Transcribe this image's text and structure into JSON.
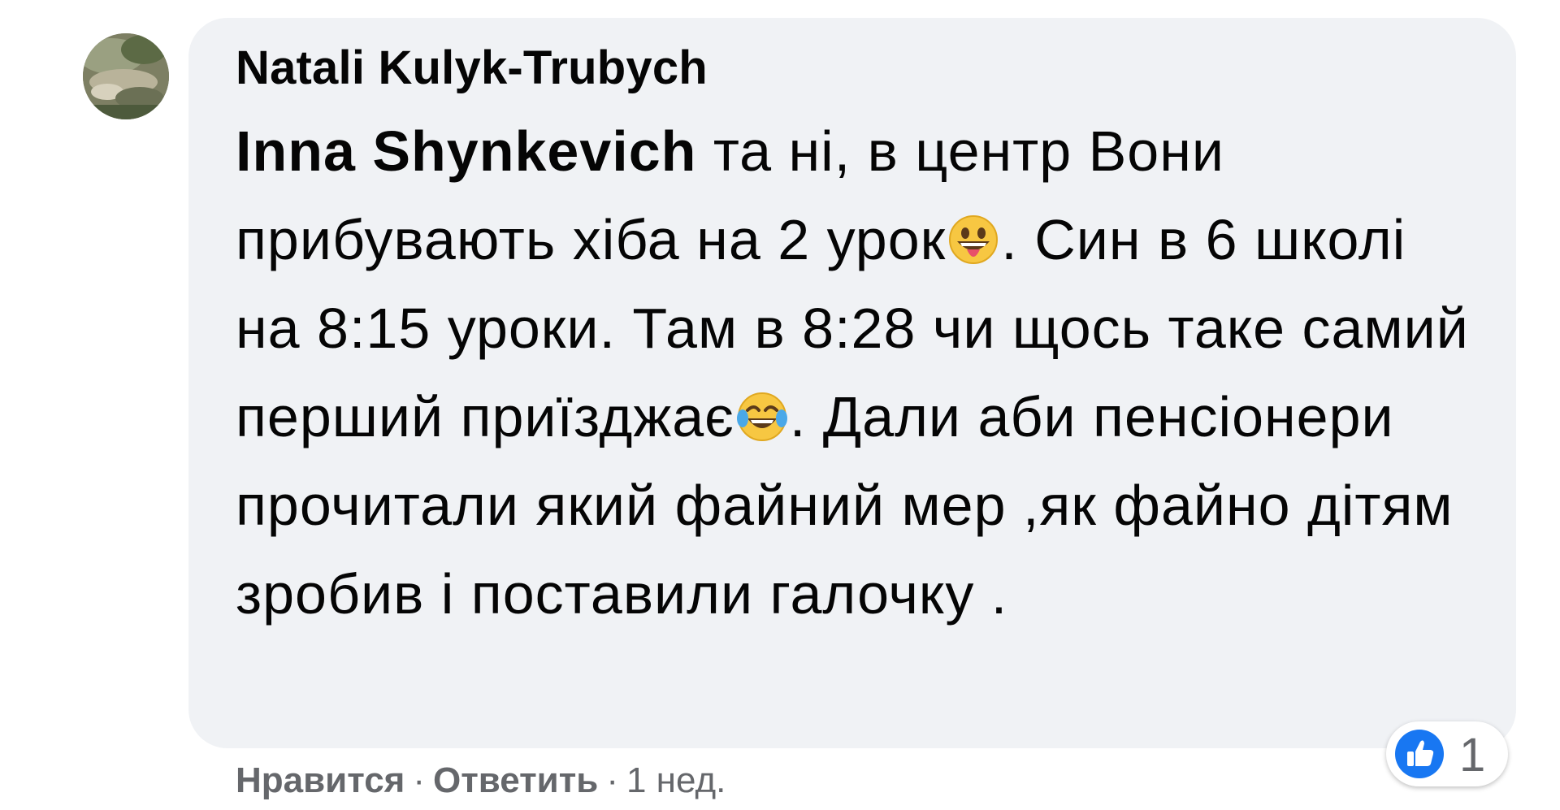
{
  "comment": {
    "author": "Natali Kulyk-Trubych",
    "mention": "Inna Shynkevich",
    "text_1": " та ні, в центр Вони прибувають хіба на 2 урок",
    "emoji_1": "grinning-tongue-emoji",
    "text_2": ". Син в 6 школі на 8:15 уроки. Там в 8:28 чи щось таке самий перший приїзджає",
    "emoji_2": "tears-of-joy-emoji",
    "text_3": ". Дали аби пенсіонери прочитали який файний мер ,як файно дітям зробив і поставили галочку ."
  },
  "reactions": {
    "icon": "like-icon",
    "count": "1",
    "color": "#1877f2"
  },
  "actions": {
    "like_label": "Нравится",
    "reply_label": "Ответить",
    "separator": "·",
    "timestamp": "1 нед."
  },
  "colors": {
    "bubble": "#f0f2f5",
    "text": "#050505",
    "secondary": "#65676b"
  }
}
